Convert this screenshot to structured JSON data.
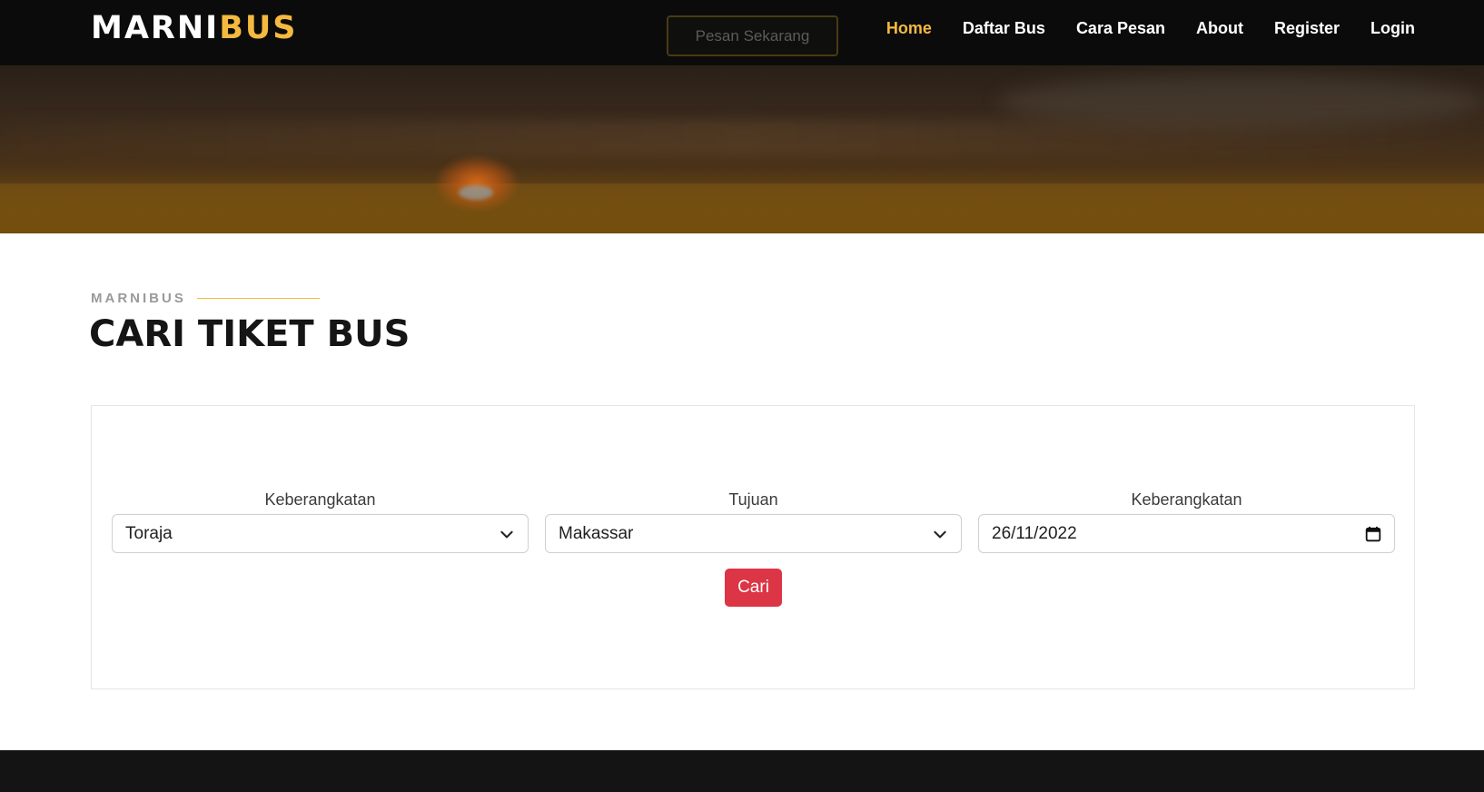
{
  "header": {
    "logo_part1": "MARNI",
    "logo_part2": "BUS",
    "cta_label": "Pesan Sekarang",
    "nav": [
      {
        "label": "Home"
      },
      {
        "label": "Daftar Bus"
      },
      {
        "label": "Cara Pesan"
      },
      {
        "label": "About"
      },
      {
        "label": "Register"
      },
      {
        "label": "Login"
      }
    ],
    "active_nav": "Home"
  },
  "section": {
    "eyebrow": "MARNIBUS",
    "title": "CARI TIKET BUS"
  },
  "form": {
    "from": {
      "label": "Keberangkatan",
      "value": "Toraja"
    },
    "to": {
      "label": "Tujuan",
      "value": "Makassar"
    },
    "date": {
      "label": "Keberangkatan",
      "value": "26/11/2022"
    },
    "submit_label": "Cari"
  },
  "icons": {
    "select": "chevron-down-icon",
    "date": "calendar-icon"
  },
  "colors": {
    "accent": "#f5b940",
    "header_bg": "#0b0b0b",
    "button": "#dc3545",
    "footer_bg": "#141414"
  }
}
